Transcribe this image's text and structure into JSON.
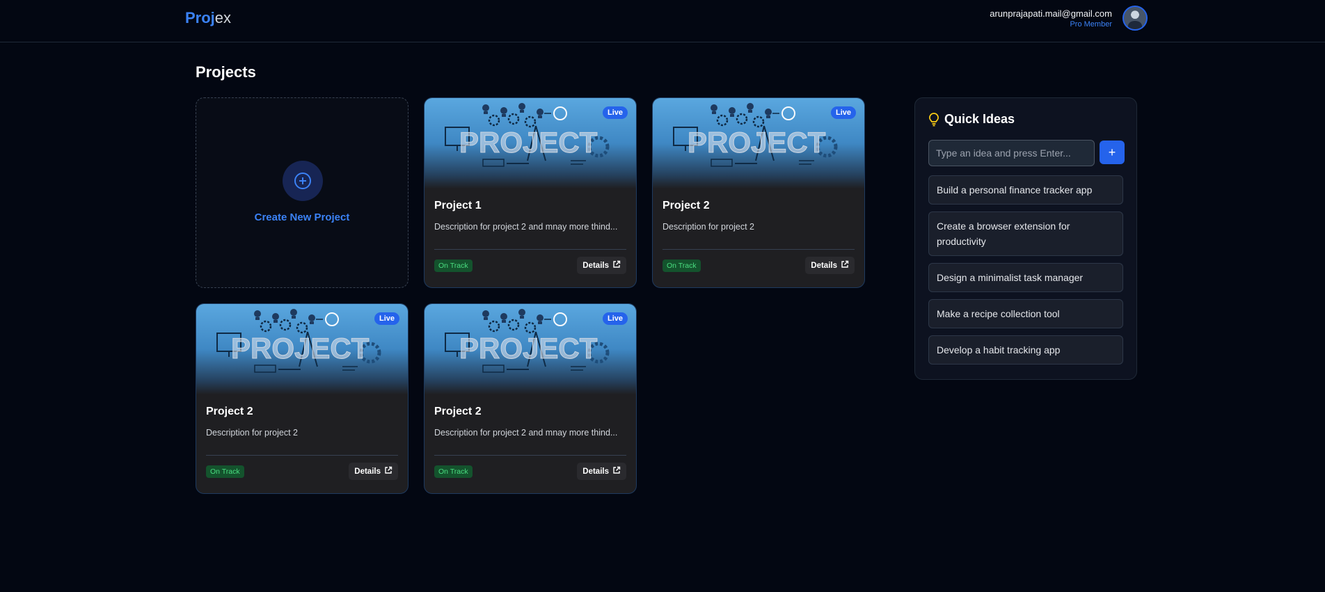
{
  "header": {
    "logo_part1": "Proj",
    "logo_part2": "ex",
    "user_email": "arunprajapati.mail@gmail.com",
    "user_role": "Pro Member"
  },
  "page_title": "Projects",
  "create_label": "Create New Project",
  "projects": [
    {
      "title": "Project 1",
      "description": "Description for project 2 and mnay more thind...",
      "badge": "Live",
      "status": "On Track",
      "details": "Details"
    },
    {
      "title": "Project 2",
      "description": "Description for project 2",
      "badge": "Live",
      "status": "On Track",
      "details": "Details"
    },
    {
      "title": "Project 2",
      "description": "Description for project 2",
      "badge": "Live",
      "status": "On Track",
      "details": "Details"
    },
    {
      "title": "Project 2",
      "description": "Description for project 2 and mnay more thind...",
      "badge": "Live",
      "status": "On Track",
      "details": "Details"
    }
  ],
  "thumbnail_text": "PROJECT",
  "quick_ideas": {
    "title": "Quick Ideas",
    "placeholder": "Type an idea and press Enter...",
    "add_label": "+",
    "items": [
      "Build a personal finance tracker app",
      "Create a browser extension for productivity",
      "Design a minimalist task manager",
      "Make a recipe collection tool",
      "Develop a habit tracking app"
    ]
  },
  "colors": {
    "accent": "#3b82f6",
    "background": "#030712",
    "card": "#1f1f22",
    "status_bg": "#14532d",
    "status_fg": "#4ade80",
    "idea_icon": "#facc15"
  },
  "icons": {
    "create": "plus-circle-icon",
    "details": "external-link-icon",
    "ideas": "lightbulb-icon"
  }
}
